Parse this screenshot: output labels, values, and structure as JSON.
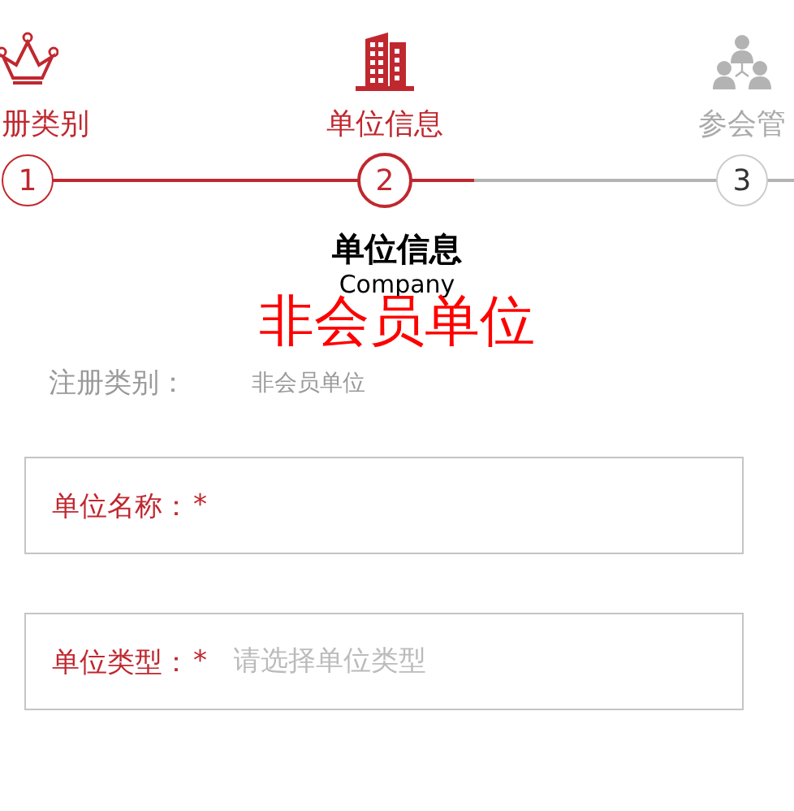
{
  "steps": [
    {
      "label": "册类别",
      "number": "1",
      "kind": "crown",
      "done": true,
      "selected": false
    },
    {
      "label": "单位信息",
      "number": "2",
      "kind": "building",
      "done": false,
      "selected": true
    },
    {
      "label": "参会管",
      "number": "3",
      "kind": "people",
      "done": false,
      "selected": false
    }
  ],
  "section": {
    "title": "单位信息",
    "subtitle": "Company",
    "highlight": "非会员单位"
  },
  "registration": {
    "label": "注册类别：",
    "value": "非会员单位"
  },
  "fields": [
    {
      "label": "单位名称：",
      "required_mark": "*"
    },
    {
      "label": "单位类型：",
      "required_mark": "*",
      "placeholder": "请选择单位类型"
    }
  ]
}
